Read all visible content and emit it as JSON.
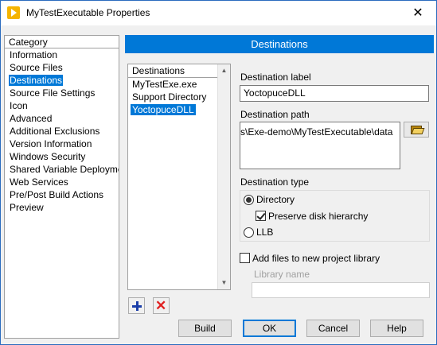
{
  "window": {
    "title": "MyTestExecutable Properties",
    "close_glyph": "✕",
    "icon": "labview-app-icon"
  },
  "category": {
    "header": "Category",
    "items": [
      {
        "label": "Information",
        "selected": false
      },
      {
        "label": "Source Files",
        "selected": false
      },
      {
        "label": "Destinations",
        "selected": true
      },
      {
        "label": "Source File Settings",
        "selected": false
      },
      {
        "label": "Icon",
        "selected": false
      },
      {
        "label": "Advanced",
        "selected": false
      },
      {
        "label": "Additional Exclusions",
        "selected": false
      },
      {
        "label": "Version Information",
        "selected": false
      },
      {
        "label": "Windows Security",
        "selected": false
      },
      {
        "label": "Shared Variable Deployment",
        "selected": false
      },
      {
        "label": "Web Services",
        "selected": false
      },
      {
        "label": "Pre/Post Build Actions",
        "selected": false
      },
      {
        "label": "Preview",
        "selected": false
      }
    ]
  },
  "section_title": "Destinations",
  "destinations": {
    "header": "Destinations",
    "items": [
      {
        "label": "MyTestExe.exe",
        "selected": false
      },
      {
        "label": "Support Directory",
        "selected": false
      },
      {
        "label": "YoctopuceDLL",
        "selected": true
      }
    ],
    "scroll_up": "▲",
    "scroll_down": "▼",
    "add_icon": "plus-icon",
    "remove_icon": "x-icon",
    "remove_glyph": "✕"
  },
  "form": {
    "destination_label_caption": "Destination label",
    "destination_label_value": "YoctopuceDLL",
    "destination_path_caption": "Destination path",
    "destination_path_value": "s\\Exe-demo\\MyTestExecutable\\data",
    "browse_icon": "folder-open-icon",
    "destination_type_caption": "Destination type",
    "type_directory_label": "Directory",
    "type_directory_selected": true,
    "preserve_hierarchy_label": "Preserve disk hierarchy",
    "preserve_hierarchy_checked": true,
    "type_llb_label": "LLB",
    "type_llb_selected": false,
    "add_to_library_label": "Add files to new project library",
    "add_to_library_checked": false,
    "library_name_caption": "Library name",
    "library_name_value": ""
  },
  "buttons": {
    "build": "Build",
    "ok": "OK",
    "cancel": "Cancel",
    "help": "Help"
  },
  "colors": {
    "accent": "#0078d7",
    "remove": "#e02020",
    "add": "#1a3ea8"
  }
}
